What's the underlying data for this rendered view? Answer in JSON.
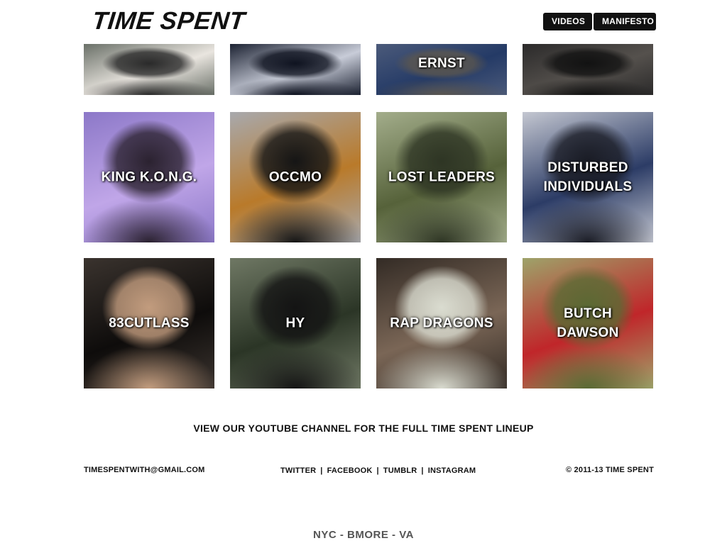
{
  "header": {
    "logo": "TIME SPENT",
    "nav": [
      {
        "label": "VIDEOS"
      },
      {
        "label": "MANIFESTO"
      }
    ]
  },
  "grid": {
    "row0": [
      {
        "label": "",
        "colors": [
          "#6a7068",
          "#e9e5df",
          "#2a2a2a"
        ]
      },
      {
        "label": "",
        "colors": [
          "#1d2333",
          "#c8ccd8",
          "#0f1320"
        ]
      },
      {
        "label": "ERNST",
        "colors": [
          "#4b5a7a",
          "#243a66",
          "#5a5650"
        ]
      },
      {
        "label": "",
        "colors": [
          "#2b2a2a",
          "#55514d",
          "#121212"
        ]
      }
    ],
    "row1": [
      {
        "label": "KING K.O.N.G.",
        "colors": [
          "#8c78c8",
          "#c0a6e8",
          "#2b2230"
        ]
      },
      {
        "label": "OCCMO",
        "colors": [
          "#a8a9ad",
          "#b97a2a",
          "#151515"
        ]
      },
      {
        "label": "LOST LEADERS",
        "colors": [
          "#a3ad8b",
          "#56623a",
          "#2e3524"
        ]
      },
      {
        "label": "DISTURBED INDIVIDUALS",
        "colors": [
          "#c4c7d1",
          "#2c3c66",
          "#1a1c25"
        ]
      }
    ],
    "row2": [
      {
        "label": "83CUTLASS",
        "colors": [
          "#3a332e",
          "#0e0c0b",
          "#c29c7e"
        ]
      },
      {
        "label": "HY",
        "colors": [
          "#6f7864",
          "#2b3526",
          "#141414"
        ]
      },
      {
        "label": "RAP DRAGONS",
        "colors": [
          "#332b25",
          "#7a6656",
          "#dadcd0"
        ]
      },
      {
        "label": "BUTCH DAWSON",
        "colors": [
          "#9ea36a",
          "#c0262a",
          "#5a6a34"
        ]
      }
    ]
  },
  "cta": "VIEW OUR YOUTUBE CHANNEL FOR THE FULL TIME SPENT LINEUP",
  "footer": {
    "email": "TIMESPENTWITH@GMAIL.COM",
    "social": [
      "TWITTER",
      "FACEBOOK",
      "TUMBLR",
      "INSTAGRAM"
    ],
    "copyright": "© 2011-13 TIME SPENT"
  },
  "cities": "NYC - BMORE - VA"
}
